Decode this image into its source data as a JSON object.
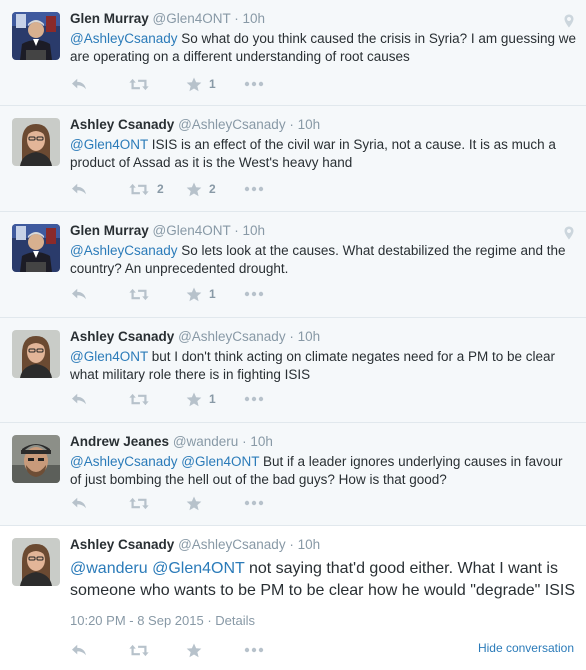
{
  "tweets": [
    {
      "fullname": "Glen Murray",
      "screenname": "@Glen4ONT",
      "time": "10h",
      "mention": "@AshleyCsanady",
      "mention2": "",
      "text": " So what do you think caused the crisis in Syria? I am guessing we are operating on a different understanding of root causes",
      "retweets": "",
      "favorites": "1",
      "geo": true,
      "avatar": "glen"
    },
    {
      "fullname": "Ashley Csanady",
      "screenname": "@AshleyCsanady",
      "time": "10h",
      "mention": "@Glen4ONT",
      "mention2": "",
      "text": " ISIS is an effect of the civil war in Syria, not a cause. It is as much a product of Assad as it is the West's heavy hand",
      "retweets": "2",
      "favorites": "2",
      "geo": false,
      "avatar": "ashley"
    },
    {
      "fullname": "Glen Murray",
      "screenname": "@Glen4ONT",
      "time": "10h",
      "mention": "@AshleyCsanady",
      "mention2": "",
      "text": " So lets look at the causes. What destabilized the regime and the country? An unprecedented drought.",
      "retweets": "",
      "favorites": "1",
      "geo": true,
      "avatar": "glen"
    },
    {
      "fullname": "Ashley Csanady",
      "screenname": "@AshleyCsanady",
      "time": "10h",
      "mention": "@Glen4ONT",
      "mention2": "",
      "text": " but I don't think acting on climate negates need for a PM to be clear what military role there is in fighting ISIS",
      "retweets": "",
      "favorites": "1",
      "geo": false,
      "avatar": "ashley"
    },
    {
      "fullname": "Andrew Jeanes",
      "screenname": "@wanderu",
      "time": "10h",
      "mention": "@AshleyCsanady",
      "mention2": "@Glen4ONT",
      "text": " But if a leader ignores underlying causes in favour of just bombing the hell out of the bad guys? How is that good?",
      "retweets": "",
      "favorites": "",
      "geo": false,
      "avatar": "andrew"
    }
  ],
  "focus": {
    "fullname": "Ashley Csanady",
    "screenname": "@AshleyCsanady",
    "time": "10h",
    "mention": "@wanderu",
    "mention2": "@Glen4ONT",
    "text": " not saying that'd good either. What I want is someone who wants to be PM to be clear how he would \"degrade\" ISIS",
    "timestamp": "10:20 PM - 8 Sep 2015",
    "separator": " · ",
    "details": "Details",
    "hide_conversation": "Hide conversation"
  },
  "separator": " · ",
  "colors": {
    "mention": "#2b7bb9",
    "muted": "#8899a6",
    "divider": "#e1e8ed",
    "thread_bg": "#f5f8fa"
  },
  "icons": [
    "reply-icon",
    "retweet-icon",
    "favorite-icon",
    "more-icon",
    "geo-pin-icon"
  ]
}
